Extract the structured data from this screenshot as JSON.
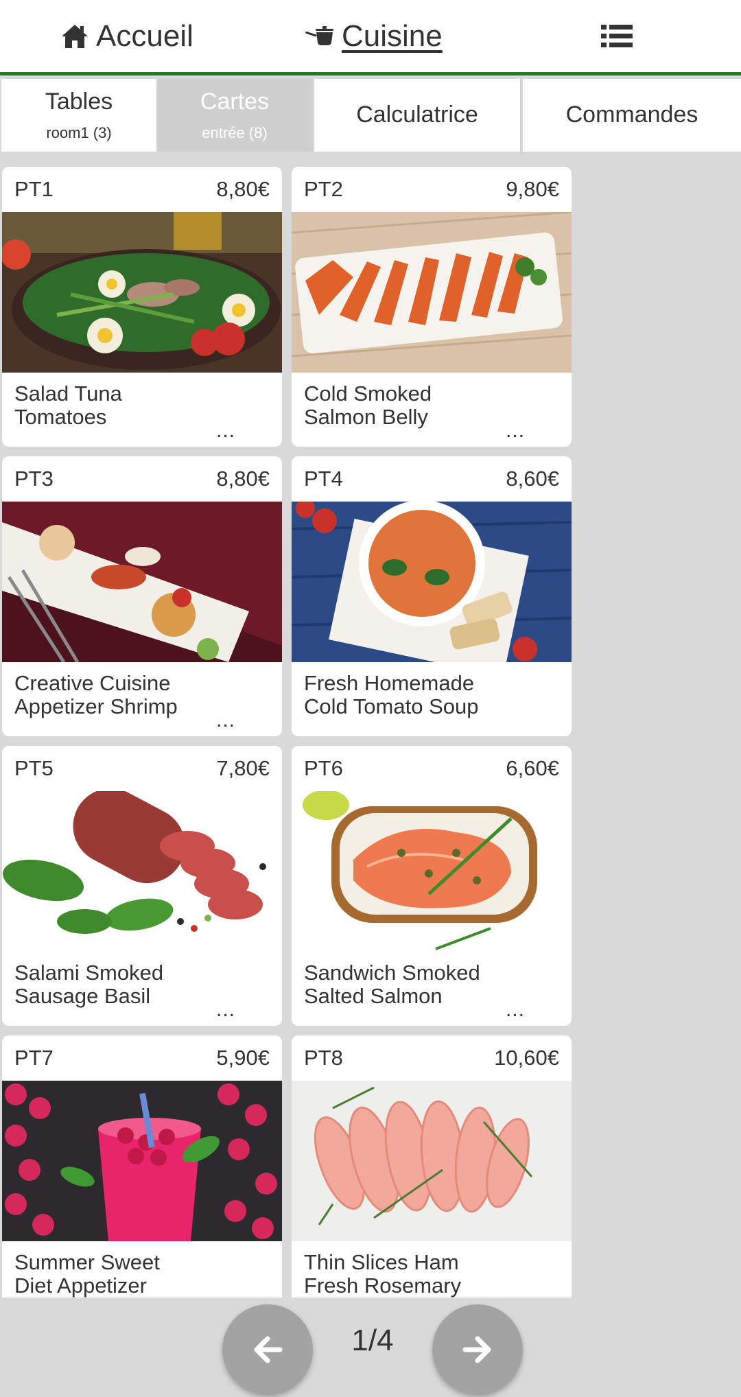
{
  "nav": {
    "home_label": "Accueil",
    "cuisine_label": "Cuisine",
    "home_icon": "home-icon",
    "cuisine_icon": "cooking-pot-icon",
    "list_icon": "list-icon"
  },
  "tabs": [
    {
      "label": "Tables",
      "sub": "room1 (3)"
    },
    {
      "label": "Cartes",
      "sub": "entrée (8)",
      "active": true
    },
    {
      "label": "Calculatrice"
    },
    {
      "label": "Commandes"
    }
  ],
  "products": [
    {
      "code": "PT1",
      "price": "8,80€",
      "name_line1": "Salad Tuna",
      "name_line2": "Tomatoes",
      "more": "...",
      "image": "salad-image"
    },
    {
      "code": "PT2",
      "price": "9,80€",
      "name_line1": "Cold Smoked",
      "name_line2": "Salmon Belly",
      "more": "...",
      "image": "salmon-belly-image"
    },
    {
      "code": "PT3",
      "price": "8,80€",
      "name_line1": "Creative Cuisine",
      "name_line2": "Appetizer Shrimp",
      "more": "...",
      "image": "shrimp-appetizer-image"
    },
    {
      "code": "PT4",
      "price": "8,60€",
      "name_line1": "Fresh Homemade",
      "name_line2": "Cold Tomato Soup",
      "more": "",
      "image": "tomato-soup-image"
    },
    {
      "code": "PT5",
      "price": "7,80€",
      "name_line1": "Salami Smoked",
      "name_line2": "Sausage Basil",
      "more": "...",
      "image": "salami-image"
    },
    {
      "code": "PT6",
      "price": "6,60€",
      "name_line1": "Sandwich Smoked",
      "name_line2": "Salted Salmon",
      "more": "...",
      "image": "salmon-sandwich-image"
    },
    {
      "code": "PT7",
      "price": "5,90€",
      "name_line1": "Summer Sweet",
      "name_line2": "Diet Appetizer",
      "more": "...",
      "image": "raspberry-smoothie-image"
    },
    {
      "code": "PT8",
      "price": "10,60€",
      "name_line1": "Thin Slices Ham",
      "name_line2": "Fresh Rosemary",
      "more": "",
      "image": "ham-slices-image"
    }
  ],
  "pager": {
    "page": "1/4",
    "prev_icon": "arrow-left-icon",
    "next_icon": "arrow-right-icon"
  },
  "colors": {
    "accent": "#1e7d1e",
    "active_tab": "#cfcfcf",
    "background": "#d9d9d9",
    "pager_button": "#a3a3a3"
  }
}
